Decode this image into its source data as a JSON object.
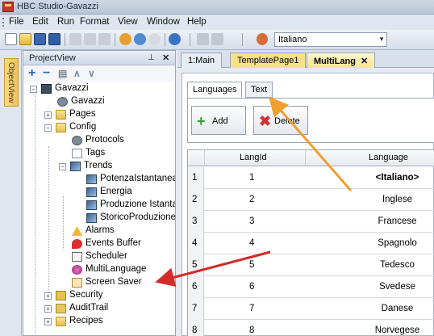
{
  "window": {
    "title": "HBC Studio-Gavazzi"
  },
  "menu": {
    "items": [
      "File",
      "Edit",
      "Run",
      "Format",
      "View",
      "Window",
      "Help"
    ]
  },
  "toolbar": {
    "language_value": "Italiano"
  },
  "side": {
    "objectview_label": "ObjectView"
  },
  "project": {
    "title": "ProjectView",
    "tree": {
      "root": "Gavazzi",
      "gavazzi_child": "Gavazzi",
      "pages": "Pages",
      "config": "Config",
      "protocols": "Protocols",
      "tags": "Tags",
      "trends": "Trends",
      "trend_items": [
        "PotenzaIstantanea",
        "Energia",
        "Produzione Istanta",
        "StoricoProduzione"
      ],
      "alarms": "Alarms",
      "events": "Events Buffer",
      "scheduler": "Scheduler",
      "multilanguage": "MultiLanguage",
      "screensaver": "Screen Saver",
      "security": "Security",
      "audit": "AuditTrail",
      "recipes": "Recipes"
    }
  },
  "editor": {
    "tabs": [
      {
        "label": "1:Main"
      },
      {
        "label": "TemplatePage1"
      },
      {
        "label": "MultiLang"
      }
    ],
    "inner_tabs": [
      "Languages",
      "Text"
    ],
    "buttons": {
      "add": "Add",
      "delete": "Delete"
    },
    "grid": {
      "headers": [
        "LangId",
        "Language"
      ],
      "rows": [
        {
          "n": "1",
          "id": "1",
          "lang": "<Italiano>"
        },
        {
          "n": "2",
          "id": "2",
          "lang": "Inglese"
        },
        {
          "n": "3",
          "id": "3",
          "lang": "Francese"
        },
        {
          "n": "4",
          "id": "4",
          "lang": "Spagnolo"
        },
        {
          "n": "5",
          "id": "5",
          "lang": "Tedesco"
        },
        {
          "n": "6",
          "id": "6",
          "lang": "Svedese"
        },
        {
          "n": "7",
          "id": "7",
          "lang": "Danese"
        },
        {
          "n": "8",
          "id": "8",
          "lang": "Norvegese"
        }
      ]
    }
  },
  "colors": {
    "orange_arrow": "#f0a030",
    "red_arrow": "#d42a2a"
  }
}
